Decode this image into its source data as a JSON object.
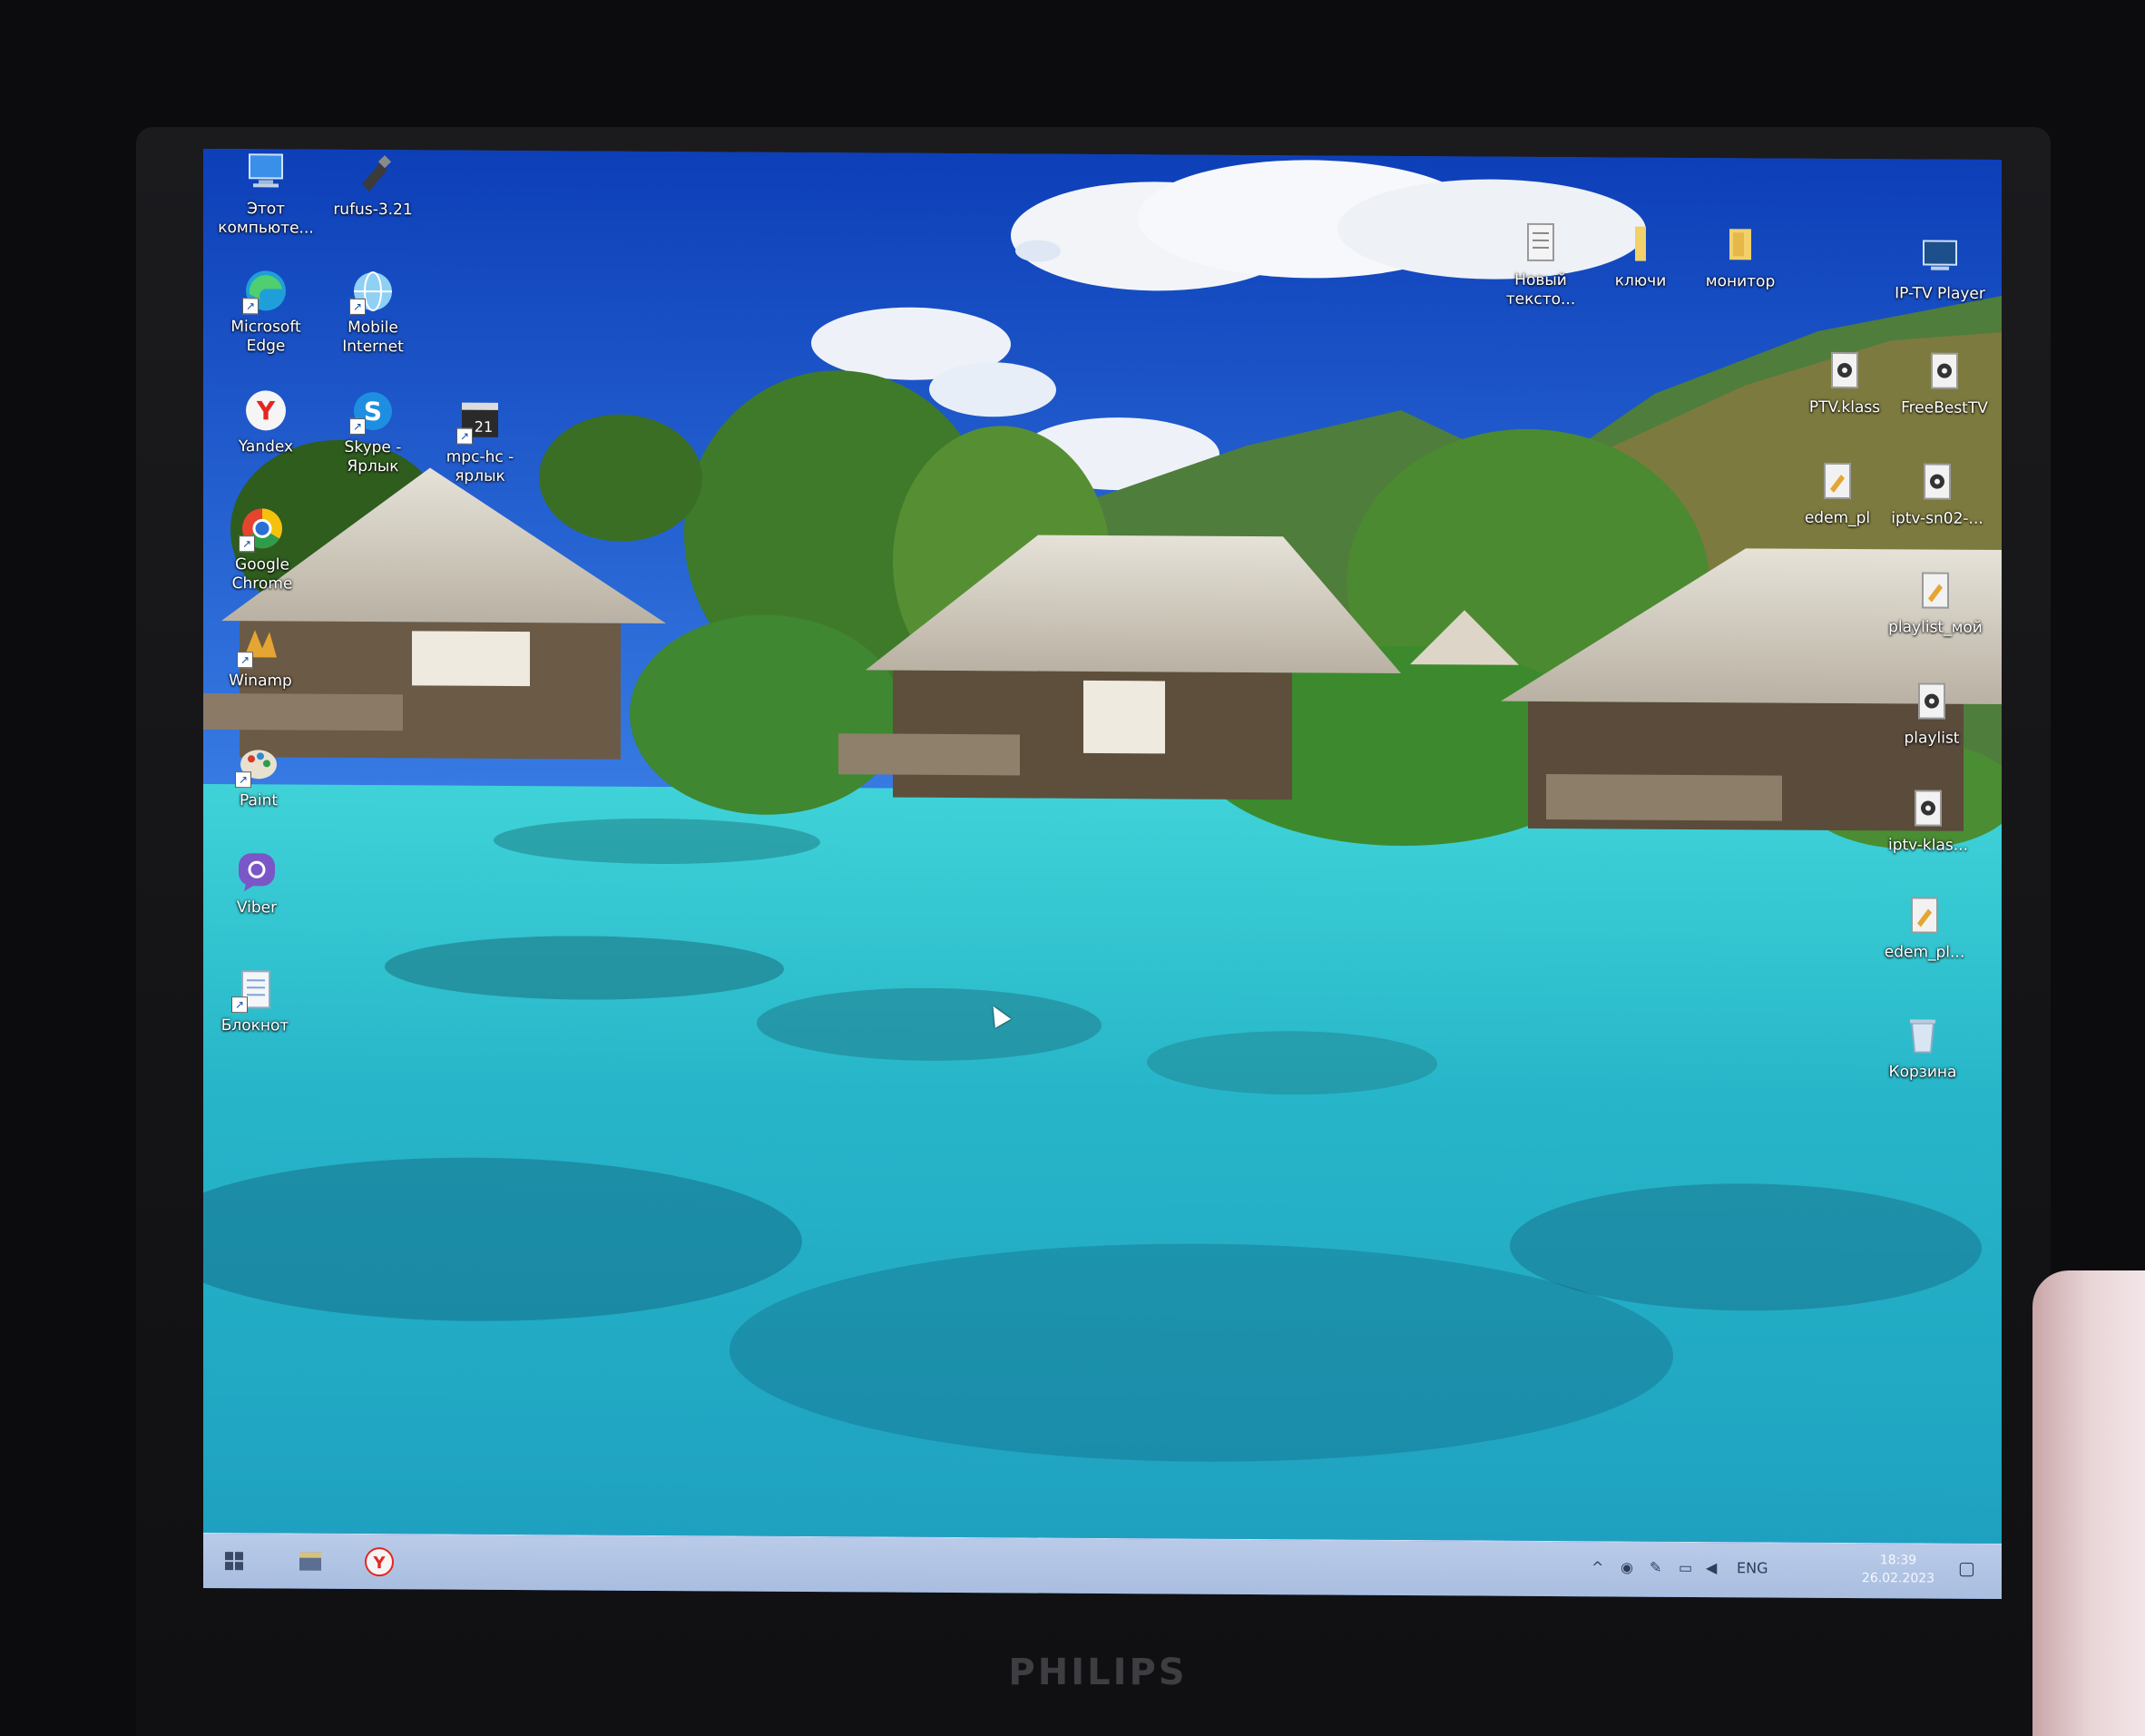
{
  "monitor": {
    "brand": "PHILIPS"
  },
  "desktop": {
    "left_icons": [
      {
        "label": "Этот компьюте...",
        "icon": "computer-icon",
        "shortcut": false
      },
      {
        "label": "rufus-3.21",
        "icon": "usb-icon",
        "shortcut": false
      },
      {
        "label": "Microsoft Edge",
        "icon": "edge-icon",
        "shortcut": true
      },
      {
        "label": "Mobile Internet",
        "icon": "globe-icon",
        "shortcut": true
      },
      {
        "label": "Yandex",
        "icon": "yandex-icon",
        "shortcut": false
      },
      {
        "label": "Skype - Ярлык",
        "icon": "skype-icon",
        "shortcut": true
      },
      {
        "label": "mpc-hc - ярлык",
        "icon": "media-player-icon",
        "shortcut": true
      },
      {
        "label": "Google Chrome",
        "icon": "chrome-icon",
        "shortcut": true
      },
      {
        "label": "Winamp",
        "icon": "winamp-icon",
        "shortcut": true
      },
      {
        "label": "Paint",
        "icon": "paint-icon",
        "shortcut": true
      },
      {
        "label": "Viber",
        "icon": "viber-icon",
        "shortcut": false
      },
      {
        "label": "Блокнот",
        "icon": "notepad-icon",
        "shortcut": true
      }
    ],
    "right_icons": [
      {
        "label": "Новый тексто...",
        "icon": "text-file-icon"
      },
      {
        "label": "ключи",
        "icon": "folder-icon"
      },
      {
        "label": "монитор",
        "icon": "folder-icon"
      },
      {
        "label": "IP-TV Player",
        "icon": "iptv-icon"
      },
      {
        "label": "PTV.klass",
        "icon": "playlist-icon"
      },
      {
        "label": "FreeBestTV",
        "icon": "playlist-icon"
      },
      {
        "label": "edem_pl",
        "icon": "playlist-file-icon"
      },
      {
        "label": "iptv-sn02-...",
        "icon": "playlist-icon"
      },
      {
        "label": "playlist_мой",
        "icon": "playlist-file-icon"
      },
      {
        "label": "playlist",
        "icon": "playlist-icon"
      },
      {
        "label": "iptv-klas...",
        "icon": "playlist-icon"
      },
      {
        "label": "edem_pl...",
        "icon": "playlist-file-icon"
      },
      {
        "label": "Корзина",
        "icon": "recycle-bin-icon"
      }
    ]
  },
  "taskbar": {
    "start": "windows-start-icon",
    "pinned": [
      "file-explorer-icon",
      "yandex-browser-icon"
    ],
    "tray": {
      "chevron": "^",
      "language": "ENG",
      "time": "18:39",
      "date": "26.02.2023"
    }
  },
  "colors": {
    "sky": "#1f5fd6",
    "water": "#2ec4cf",
    "taskbar": "#b0c4e4"
  }
}
